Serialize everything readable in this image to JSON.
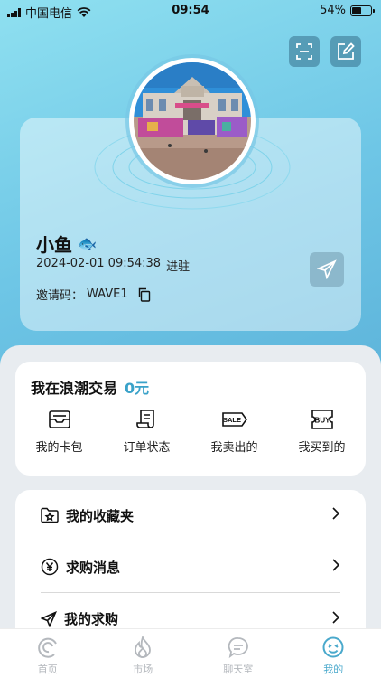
{
  "status_bar": {
    "carrier": "中国电信",
    "time": "09:54",
    "battery": "54%",
    "battery_level": 0.54
  },
  "profile": {
    "username": "小鱼",
    "username_emoji": "🐟",
    "join_date": "2024-02-01 09:54:38",
    "join_suffix": "进驻",
    "invite_label": "邀请码：",
    "invite_code": "WAVE1"
  },
  "trade": {
    "title": "我在浪潮交易",
    "amount": "0元",
    "items": [
      {
        "label": "我的卡包",
        "icon": "card-wallet-icon"
      },
      {
        "label": "订单状态",
        "icon": "receipt-icon"
      },
      {
        "label": "我卖出的",
        "icon": "sale-tag-icon",
        "badge": "SALE"
      },
      {
        "label": "我买到的",
        "icon": "buy-ticket-icon",
        "badge": "BUY"
      }
    ]
  },
  "menu": [
    {
      "label": "我的收藏夹",
      "icon": "favorites-folder-icon"
    },
    {
      "label": "求购消息",
      "icon": "yen-circle-icon"
    },
    {
      "label": "我的求购",
      "icon": "send-arrow-icon"
    }
  ],
  "tabs": [
    {
      "label": "首页",
      "icon": "wave-home-icon"
    },
    {
      "label": "市场",
      "icon": "flame-icon"
    },
    {
      "label": "聊天室",
      "icon": "chat-bubble-icon"
    },
    {
      "label": "我的",
      "icon": "smiley-profile-icon",
      "active": true
    }
  ],
  "colors": {
    "accent": "#4aa9cc",
    "amount": "#3aa2c9",
    "background_top": "#8fe0f0",
    "panel": "#e8ecf0"
  }
}
